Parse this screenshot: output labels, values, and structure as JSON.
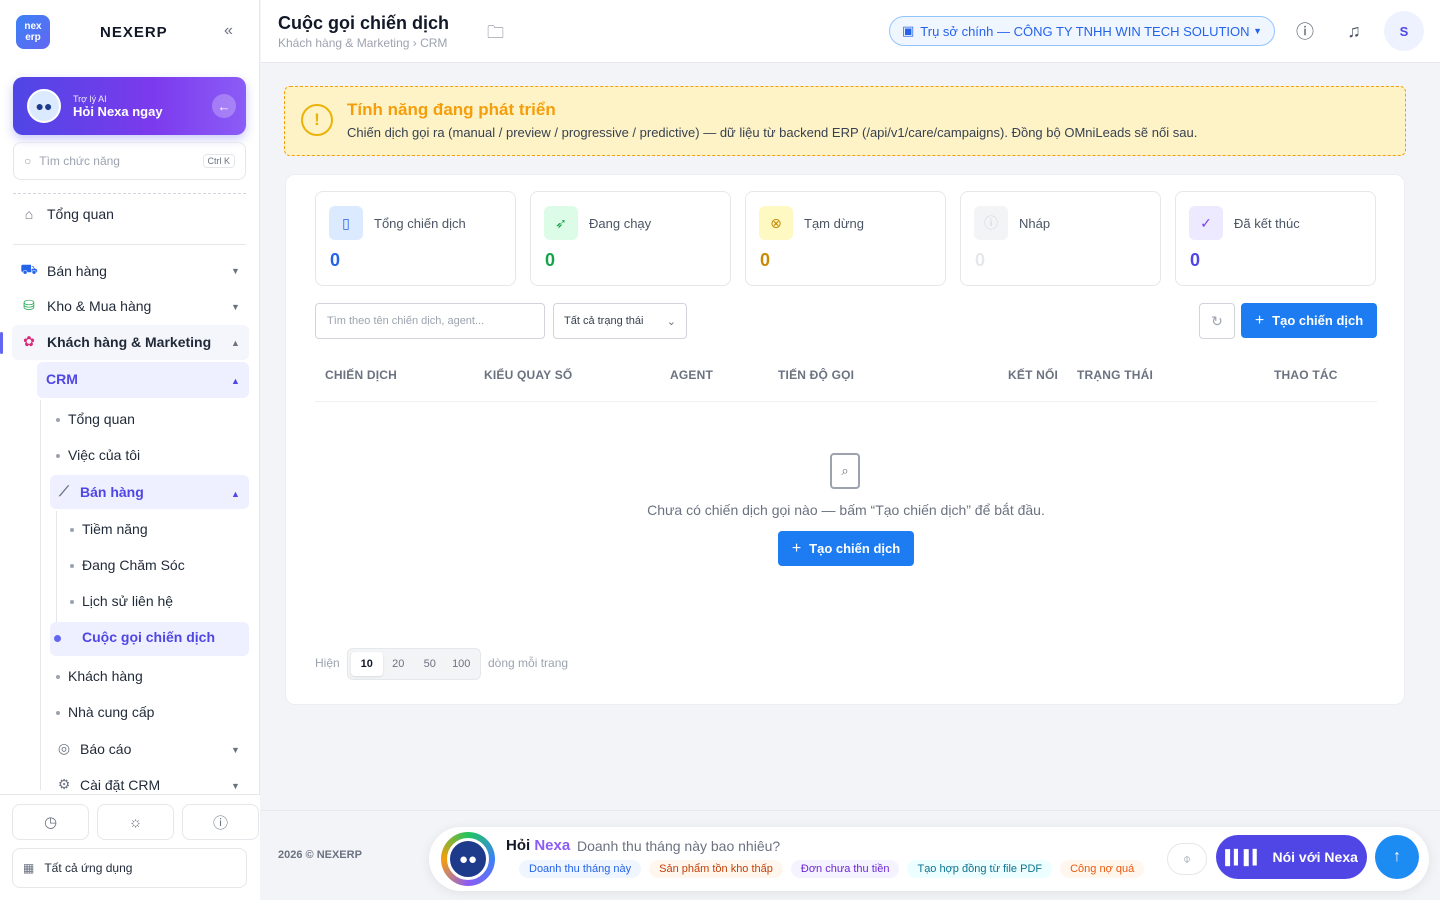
{
  "brand": {
    "logo_text": "nex erp",
    "name": "NEXERP",
    "collapse_icon": "double-chevron-left-icon"
  },
  "ai_assistant": {
    "small": "Trợ lý AI",
    "big": "Hỏi Nexa ngay"
  },
  "sidebar_search": {
    "placeholder": "Tìm chức năng",
    "shortcut": "Ctrl K"
  },
  "nav": {
    "overview": "Tổng quan",
    "sales": "Bán hàng",
    "warehouse": "Kho & Mua hàng",
    "crm_marketing": "Khách hàng & Marketing",
    "crm": "CRM",
    "crm_overview": "Tổng quan",
    "my_tasks": "Việc của tôi",
    "crm_sales": "Bán hàng",
    "leads": "Tiềm năng",
    "caring": "Đang Chăm Sóc",
    "contact_history": "Lịch sử liên hệ",
    "call_campaigns": "Cuộc gọi chiến dịch",
    "customers": "Khách hàng",
    "suppliers": "Nhà cung cấp",
    "reports": "Báo cáo",
    "crm_settings": "Cài đặt CRM"
  },
  "sidebar_footer": {
    "all_apps": "Tất cả ứng dụng"
  },
  "header": {
    "title": "Cuộc gọi chiến dịch",
    "breadcrumb": "Khách hàng & Marketing › CRM",
    "branch": "Trụ sở chính — CÔNG TY TNHH WIN TECH SOLUTION",
    "avatar_initial": "S"
  },
  "warning": {
    "title": "Tính năng đang phát triển",
    "desc": "Chiến dịch gọi ra (manual / preview / progressive / predictive) — dữ liệu từ backend ERP (/api/v1/care/campaigns). Đồng bộ OMniLeads sẽ nối sau."
  },
  "stats": [
    {
      "label": "Tổng chiến dịch",
      "value": "0",
      "color": "#2563eb"
    },
    {
      "label": "Đang chạy",
      "value": "0",
      "color": "#16a34a"
    },
    {
      "label": "Tạm dừng",
      "value": "0",
      "color": "#ca8a04"
    },
    {
      "label": "Nháp",
      "value": "0",
      "color": "#d1d5db"
    },
    {
      "label": "Đã kết thúc",
      "value": "0",
      "color": "#4f46e5"
    }
  ],
  "filters": {
    "search_placeholder": "Tìm theo tên chiến dịch, agent...",
    "status": "Tất cả trạng thái",
    "create": "Tạo chiến dịch"
  },
  "table": {
    "columns": [
      "Chiến dịch",
      "Kiểu quay số",
      "Agent",
      "Tiến độ gọi",
      "Kết nối",
      "Trạng thái",
      "Thao tác"
    ],
    "empty": "Chưa có chiến dịch gọi nào — bấm “Tạo chiến dịch” để bắt đầu.",
    "empty_create": "Tạo chiến dịch"
  },
  "pagination": {
    "show": "Hiện",
    "options": [
      "10",
      "20",
      "50",
      "100"
    ],
    "selected": "10",
    "suffix": "dòng mỗi trang"
  },
  "footer": {
    "copyright": "2026 © NEXERP",
    "ask_prefix": "Hỏi",
    "ask_name": "Nexa",
    "question": "Doanh thu tháng này bao nhiêu?",
    "chips": [
      "Doanh thu tháng này",
      "Sản phẩm tồn kho thấp",
      "Đơn chưa thu tiền",
      "Tạo hợp đồng từ file PDF",
      "Công nợ quá"
    ],
    "talk": "Nói với Nexa"
  }
}
